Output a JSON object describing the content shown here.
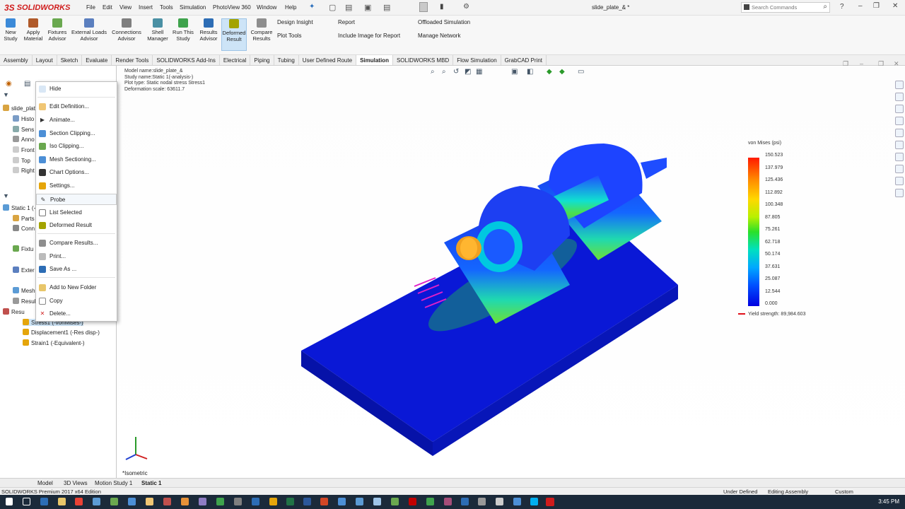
{
  "app": {
    "logo_text": "SOLIDWORKS",
    "logo_mark": "3S",
    "doc_title": "slide_plate_& *"
  },
  "menu": [
    "File",
    "Edit",
    "View",
    "Insert",
    "Tools",
    "Simulation",
    "PhotoView 360",
    "Window",
    "Help"
  ],
  "search": {
    "placeholder": "Search Commands"
  },
  "commands": [
    {
      "label": "New\nStudy",
      "icon": "new-study-icon"
    },
    {
      "label": "Apply\nMaterial",
      "icon": "apply-material-icon"
    },
    {
      "label": "Fixtures\nAdvisor",
      "icon": "fixtures-advisor-icon"
    },
    {
      "label": "External Loads\nAdvisor",
      "icon": "external-loads-icon"
    },
    {
      "label": "Connections\nAdvisor",
      "icon": "connections-advisor-icon"
    },
    {
      "label": "Shell\nManager",
      "icon": "shell-manager-icon"
    },
    {
      "label": "Run This\nStudy",
      "icon": "run-study-icon"
    },
    {
      "label": "Results\nAdvisor",
      "icon": "results-advisor-icon"
    },
    {
      "label": "Deformed\nResult",
      "icon": "deformed-result-icon"
    },
    {
      "label": "Compare\nResults",
      "icon": "compare-results-icon"
    }
  ],
  "commands_small": [
    "Design Insight",
    "Plot Tools",
    "Report",
    "Include Image for Report",
    "Offloaded Simulation",
    "Manage Network"
  ],
  "tabs": [
    "Assembly",
    "Layout",
    "Sketch",
    "Evaluate",
    "Render Tools",
    "SOLIDWORKS Add-Ins",
    "Electrical",
    "Piping",
    "Tubing",
    "User Defined Route",
    "Simulation",
    "SOLIDWORKS MBD",
    "Flow Simulation",
    "GrabCAD Print"
  ],
  "active_tab": "Simulation",
  "tree_top": [
    "slide_plat",
    "Histo",
    "Sens",
    "Anno",
    "Front",
    "Top",
    "Right"
  ],
  "tree_bottom": [
    "Static 1 (-",
    "Parts",
    "Conn",
    "Fixtu",
    "Exter",
    "Mesh",
    "Resul",
    "Resu",
    "Stress1 (-vonMises-)",
    "Displacement1 (-Res disp-)",
    "Strain1 (-Equivalent-)"
  ],
  "context_menu": [
    {
      "label": "Hide",
      "icon": "hide-icon"
    },
    {
      "label": "Edit Definition...",
      "icon": "edit-definition-icon"
    },
    {
      "label": "Animate...",
      "icon": "animate-icon"
    },
    {
      "label": "Section Clipping...",
      "icon": "section-clipping-icon"
    },
    {
      "label": "Iso Clipping...",
      "icon": "iso-clipping-icon"
    },
    {
      "label": "Mesh Sectioning...",
      "icon": "mesh-sectioning-icon"
    },
    {
      "label": "Chart Options...",
      "icon": "chart-options-icon"
    },
    {
      "label": "Settings...",
      "icon": "settings-icon"
    },
    {
      "label": "Probe",
      "icon": "probe-icon"
    },
    {
      "label": "List Selected",
      "icon": "list-selected-icon"
    },
    {
      "label": "Deformed Result",
      "icon": "deformed-result-icon"
    },
    {
      "label": "Compare Results...",
      "icon": "compare-results-icon"
    },
    {
      "label": "Print...",
      "icon": "print-icon"
    },
    {
      "label": "Save As ...",
      "icon": "save-as-icon"
    },
    {
      "label": "Add to New Folder",
      "icon": "folder-icon"
    },
    {
      "label": "Copy",
      "icon": "copy-icon"
    },
    {
      "label": "Delete...",
      "icon": "delete-icon"
    }
  ],
  "viewport_info": [
    "Model name:slide_plate_&",
    "Study name:Static 1(-analysis-)",
    "Plot type: Static nodal stress Stress1",
    "Deformation scale: 63611.7"
  ],
  "legend": {
    "title": "von Mises (psi)",
    "values": [
      "150.523",
      "137.979",
      "125.436",
      "112.892",
      "100.348",
      "87.805",
      "75.261",
      "62.718",
      "50.174",
      "37.631",
      "25.087",
      "12.544",
      "0.000"
    ],
    "yield": "Yield strength: 89,984.603",
    "yield_color": "#e0101a"
  },
  "view_name": "*Isometric",
  "bottom_tabs": [
    "Model",
    "3D Views",
    "Motion Study 1",
    "Static 1"
  ],
  "status": {
    "edition": "SOLIDWORKS Premium 2017 x64 Edition",
    "defined": "Under Defined",
    "mode": "Editing Assembly",
    "units": "Custom"
  },
  "clock": "3:45 PM"
}
